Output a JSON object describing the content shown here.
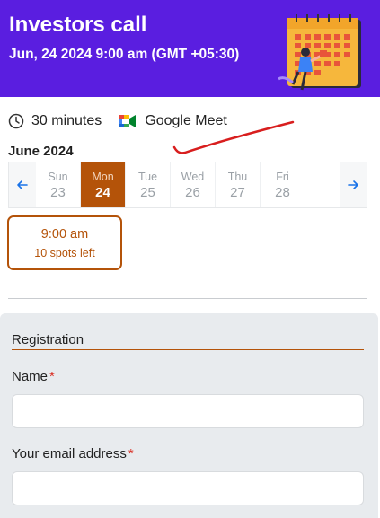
{
  "header": {
    "title": "Investors call",
    "datetime": "Jun, 24 2024 9:00 am (GMT +05:30)",
    "background_color": "#5a1ee0",
    "illustration": "calendar-illustration"
  },
  "meta": {
    "duration": "30 minutes",
    "duration_icon": "clock-icon",
    "platform": "Google Meet",
    "platform_icon": "google-meet-icon"
  },
  "calendar": {
    "month_label": "June 2024",
    "prev_icon": "arrow-left-icon",
    "next_icon": "arrow-right-icon",
    "accent_color": "#b45309",
    "days": [
      {
        "name": "Sun",
        "date": "23",
        "selected": false
      },
      {
        "name": "Mon",
        "date": "24",
        "selected": true
      },
      {
        "name": "Tue",
        "date": "25",
        "selected": false
      },
      {
        "name": "Wed",
        "date": "26",
        "selected": false
      },
      {
        "name": "Thu",
        "date": "27",
        "selected": false
      },
      {
        "name": "Fri",
        "date": "28",
        "selected": false
      }
    ]
  },
  "slots": [
    {
      "time": "9:00 am",
      "spots": "10 spots left"
    }
  ],
  "registration": {
    "title": "Registration",
    "fields": [
      {
        "label": "Name",
        "required_mark": "*",
        "value": ""
      },
      {
        "label": "Your email address",
        "required_mark": "*",
        "value": ""
      }
    ]
  }
}
